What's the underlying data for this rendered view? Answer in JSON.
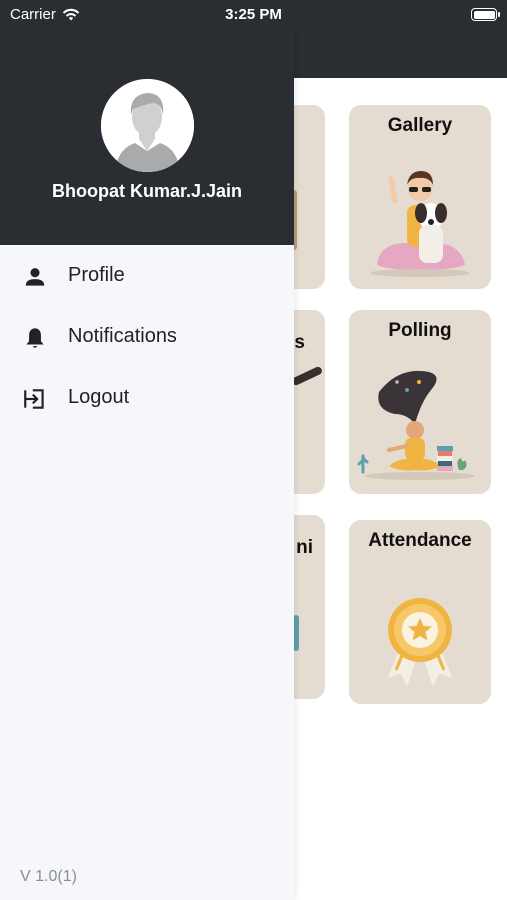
{
  "status_bar": {
    "carrier": "Carrier",
    "time": "3:25 PM"
  },
  "drawer": {
    "user_name": "Bhoopat Kumar.J.Jain",
    "menu": [
      {
        "label": "Profile",
        "icon": "person-icon"
      },
      {
        "label": "Notifications",
        "icon": "bell-icon"
      },
      {
        "label": "Logout",
        "icon": "logout-icon"
      }
    ],
    "version": "V 1.0(1)"
  },
  "dashboard": {
    "cards_right": [
      {
        "title": "Gallery",
        "illustration": "gallery-illustration"
      },
      {
        "title": "Polling",
        "illustration": "polling-illustration"
      },
      {
        "title": "Attendance",
        "illustration": "attendance-award-illustration"
      }
    ],
    "cards_left_visible_text": [
      "",
      "s",
      "ni"
    ]
  },
  "colors": {
    "header_bg": "#2a2d31",
    "drawer_bg": "#f6f7fa",
    "card_bg": "#e4dcd0",
    "version_text": "#8a8e94"
  }
}
